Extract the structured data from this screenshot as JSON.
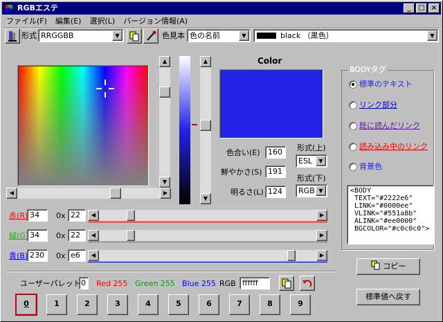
{
  "window": {
    "title": "RGBエステ",
    "min": "_",
    "max": "□",
    "close": "×"
  },
  "menu": [
    {
      "label": "ファイル(F)"
    },
    {
      "label": "編集(E)"
    },
    {
      "label": "選択(L)"
    },
    {
      "label": "バージョン情報(A)"
    }
  ],
  "toolbar": {
    "format_label": "形式",
    "format_value": "RRGGBB",
    "sample_label": "色見本",
    "sample_value": "色の名前",
    "color_name_value": "black （黒色）",
    "color_name_swatch": "#000000"
  },
  "preview": {
    "title": "Color",
    "color": "#2222e6"
  },
  "hsl": {
    "hue_label": "色合い(E)",
    "hue": "160",
    "sat_label": "鮮やかさ(S)",
    "sat": "191",
    "lum_label": "明るさ(L)",
    "lum": "124",
    "fmt_top_label": "形式(上)",
    "fmt_top": "ESL",
    "fmt_bottom_label": "形式(下)",
    "fmt_bottom": "RGB"
  },
  "rgb": {
    "red_label": "赤(R)",
    "red": "34",
    "red_hex_prefix": "0x",
    "red_hex": "22",
    "red_color": "#ff0000",
    "red_level": 0.133,
    "green_label": "緑(G)",
    "green": "34",
    "green_hex_prefix": "0x",
    "green_hex": "22",
    "green_color": "#00c000",
    "green_level": 0.133,
    "blue_label": "青(B)",
    "blue": "230",
    "blue_hex_prefix": "0x",
    "blue_hex": "e6",
    "blue_color": "#0000ff",
    "blue_level": 0.902
  },
  "body_tag": {
    "group_label": "BODYタグ",
    "options": [
      {
        "label": "標準のテキスト",
        "selected": true,
        "color": "#2222e6"
      },
      {
        "label": "リンク部分",
        "selected": false,
        "color": "#0000ee"
      },
      {
        "label": "既に読んだリンク",
        "selected": false,
        "color": "#551a8b"
      },
      {
        "label": "読み込み中のリンク",
        "selected": false,
        "color": "#ee0000"
      },
      {
        "label": "背景色",
        "selected": false,
        "color": "#2222e6"
      }
    ],
    "code": "<BODY\n TEXT=\"#2222e6\"\n LINK=\"#0000ee\"\n VLINK=\"#551a8b\"\n ALINK=\"#ee0000\"\n BGCOLOR=\"#c0c0c0\">",
    "copy_label": "コピー",
    "reset_label": "標準値へ戻す"
  },
  "palette": {
    "label": "ユーザーパレット:",
    "index": "0",
    "red_text": "Red 255",
    "green_text": "Green 255",
    "blue_text": "Blue 255",
    "rgb_label": "RGB",
    "rgb_value": "ffffff",
    "slots": [
      "0",
      "1",
      "2",
      "3",
      "4",
      "5",
      "6",
      "7",
      "8",
      "9"
    ],
    "selected": 0
  }
}
